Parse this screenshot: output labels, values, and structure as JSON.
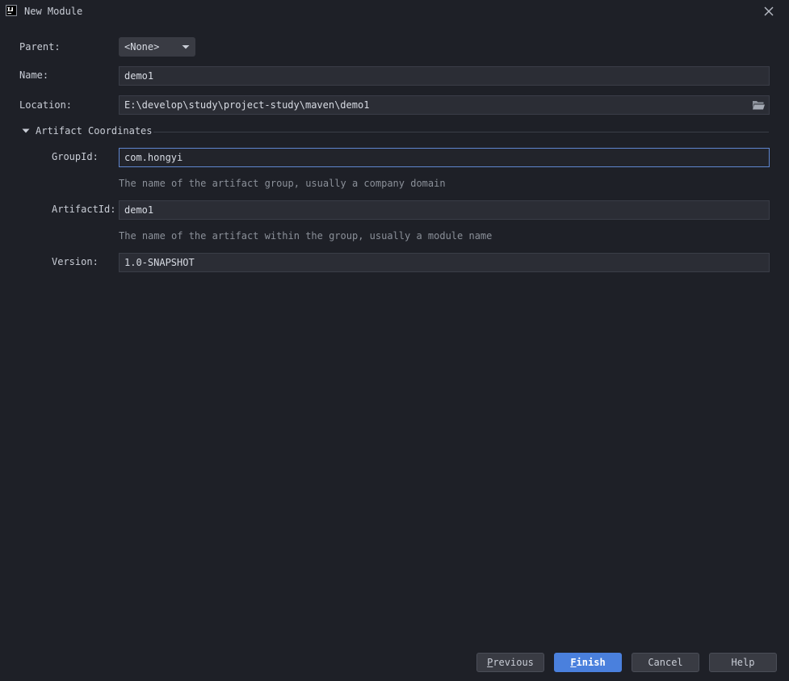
{
  "window": {
    "title": "New Module"
  },
  "form": {
    "parent_label": "Parent:",
    "parent_value": "<None>",
    "name_label": "Name:",
    "name_value": "demo1",
    "location_label": "Location:",
    "location_value": "E:\\develop\\study\\project-study\\maven\\demo1"
  },
  "artifact": {
    "section_title": "Artifact Coordinates",
    "expanded": true,
    "group_id_label": "GroupId:",
    "group_id_value": "com.hongyi",
    "group_id_hint": "The name of the artifact group, usually a company domain",
    "artifact_id_label": "ArtifactId:",
    "artifact_id_value": "demo1",
    "artifact_id_hint": "The name of the artifact within the group, usually a module name",
    "version_label": "Version:",
    "version_value": "1.0-SNAPSHOT"
  },
  "buttons": {
    "previous_mnemonic": "P",
    "previous_rest": "revious",
    "finish_mnemonic": "F",
    "finish_rest": "inish",
    "cancel": "Cancel",
    "help": "Help"
  },
  "icons": {
    "app": "intellij-idea-icon",
    "close": "close-icon",
    "dropdown": "chevron-down-icon",
    "browse": "folder-icon",
    "toggle": "triangle-down-icon"
  },
  "colors": {
    "background": "#1e2027",
    "field_background": "#2b2d35",
    "focus_border": "#5f86cf",
    "primary_button": "#4a80dd",
    "hint_text": "#8b9099"
  }
}
